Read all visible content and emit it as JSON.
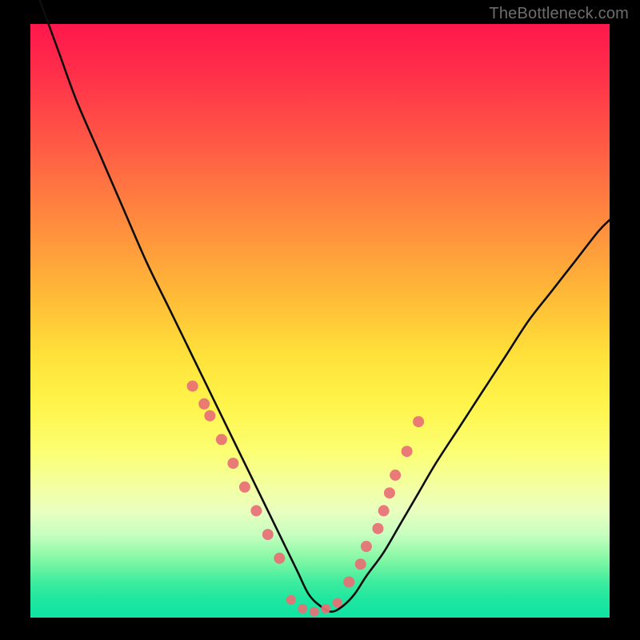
{
  "watermark": "TheBottleneck.com",
  "colors": {
    "background": "#000000",
    "curve": "#0e0e0e",
    "markers": "#e86f75",
    "bottom_band": "#10e4a2",
    "watermark_text": "#6d6d6d"
  },
  "chart_data": {
    "type": "line",
    "title": "",
    "xlabel": "",
    "ylabel": "",
    "xlim": [
      0,
      100
    ],
    "ylim": [
      0,
      100
    ],
    "x": [
      0,
      2,
      5,
      8,
      12,
      16,
      20,
      24,
      28,
      32,
      36,
      40,
      43,
      46,
      48,
      50,
      52,
      54,
      56,
      58,
      61,
      64,
      67,
      70,
      74,
      78,
      82,
      86,
      90,
      94,
      98,
      100
    ],
    "values": [
      108,
      103,
      95,
      87,
      78,
      69,
      60,
      52,
      44,
      36,
      28,
      20,
      14,
      8,
      4,
      2,
      1,
      2,
      4,
      7,
      11,
      16,
      21,
      26,
      32,
      38,
      44,
      50,
      55,
      60,
      65,
      67
    ],
    "markers": {
      "left_cluster_x": [
        28,
        30,
        31,
        33,
        35,
        37,
        39,
        41,
        43
      ],
      "left_cluster_y": [
        39,
        36,
        34,
        30,
        26,
        22,
        18,
        14,
        10
      ],
      "right_cluster_x": [
        55,
        57,
        58,
        60,
        61,
        62,
        63,
        65,
        67
      ],
      "right_cluster_y": [
        6,
        9,
        12,
        15,
        18,
        21,
        24,
        28,
        33
      ],
      "bottom_cluster_x": [
        45,
        47,
        49,
        51,
        53
      ],
      "bottom_cluster_y": [
        3,
        1.5,
        1,
        1.5,
        2.5
      ]
    },
    "note": "Values are percentage-style readings from 0 (bottom/green, optimal) to ~100 (top/red, worst). Curve shows a V-shaped bottleneck profile with markers highlighting the near-optimal region."
  }
}
